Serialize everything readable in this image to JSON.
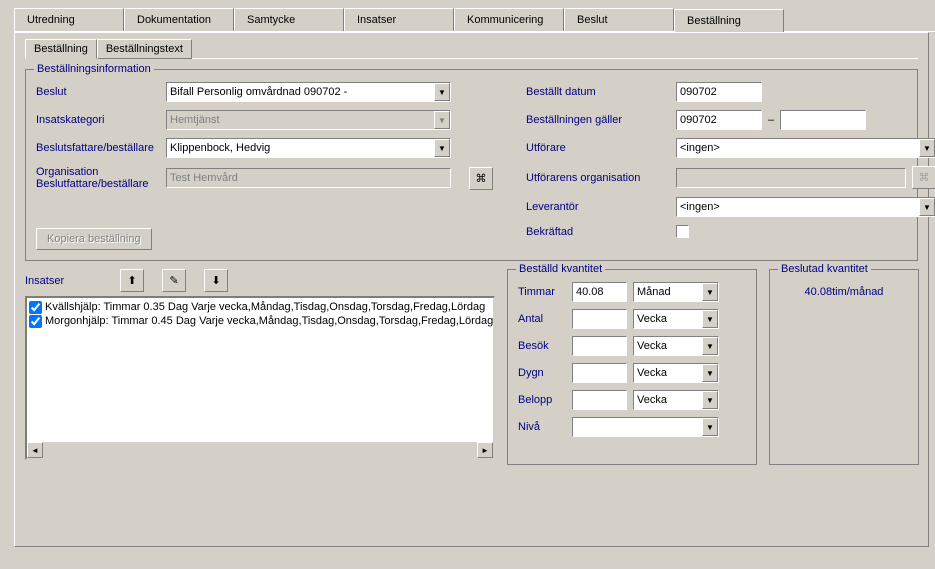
{
  "main_tabs": [
    "Utredning",
    "Dokumentation",
    "Samtycke",
    "Insatser",
    "Kommunicering",
    "Beslut",
    "Beställning"
  ],
  "active_main_tab": 6,
  "sub_tabs": [
    "Beställning",
    "Beställningstext"
  ],
  "active_sub_tab": 0,
  "group_info_title": "Beställningsinformation",
  "left": {
    "beslut_label": "Beslut",
    "beslut_value": "Bifall Personlig omvårdnad 090702 -",
    "kategori_label": "Insatskategori",
    "kategori_value": "Hemtjänst",
    "bf_label": "Beslutsfattare/beställare",
    "bf_value": "Klippenbock, Hedvig",
    "org_label_1": "Organisation",
    "org_label_2": "Beslutfattare/beställare",
    "org_value": "Test Hemvård",
    "kopiera_label": "Kopiera beställning"
  },
  "right": {
    "bestallt_label": "Beställt datum",
    "bestallt_value": "090702",
    "galler_label": "Beställningen gäller",
    "galler_from": "090702",
    "galler_to": "",
    "utforare_label": "Utförare",
    "utforare_value": "<ingen>",
    "utforg_label": "Utförarens organisation",
    "utforg_value": "",
    "lev_label": "Leverantör",
    "lev_value": "<ingen>",
    "bekraft_label": "Bekräftad"
  },
  "insatser": {
    "label": "Insatser",
    "items": [
      "Kvällshjälp:  Timmar 0.35 Dag  Varje vecka,Måndag,Tisdag,Onsdag,Torsdag,Fredag,Lördag",
      "Morgonhjälp:  Timmar 0.45 Dag  Varje vecka,Måndag,Tisdag,Onsdag,Torsdag,Fredag,Lördag"
    ]
  },
  "kvant": {
    "title": "Beställd kvantitet",
    "timmar_label": "Timmar",
    "timmar_value": "40.08",
    "timmar_unit": "Månad",
    "antal_label": "Antal",
    "antal_value": "",
    "antal_unit": "Vecka",
    "besok_label": "Besök",
    "besok_value": "",
    "besok_unit": "Vecka",
    "dygn_label": "Dygn",
    "dygn_value": "",
    "dygn_unit": "Vecka",
    "belopp_label": "Belopp",
    "belopp_value": "",
    "belopp_unit": "Vecka",
    "niva_label": "Nivå",
    "niva_value": ""
  },
  "beslutad": {
    "title": "Beslutad kvantitet",
    "value": "40.08tim/månad"
  }
}
